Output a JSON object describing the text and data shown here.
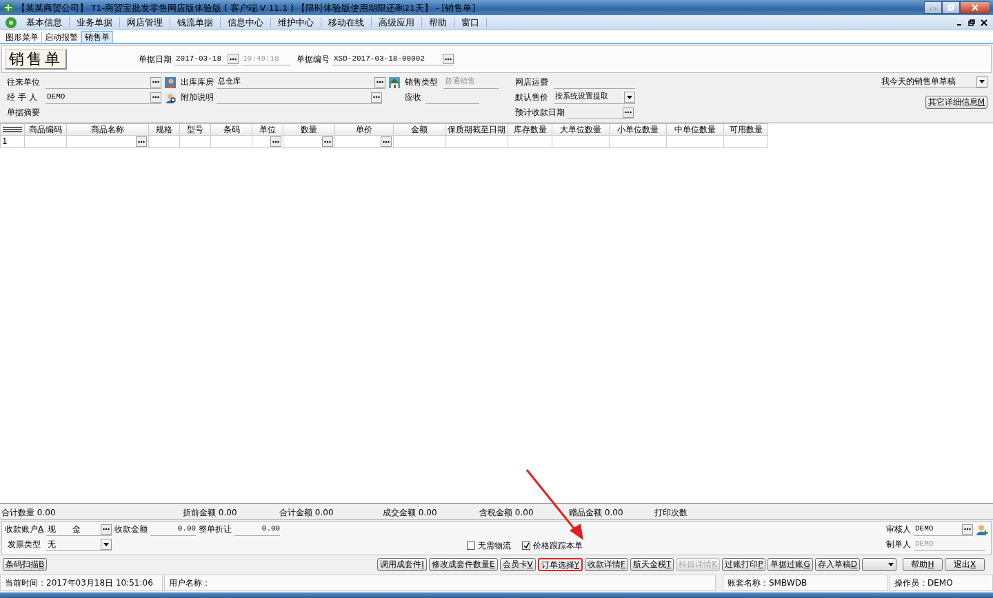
{
  "window": {
    "title": "【某某商贸公司】 T1-商贸宝批发零售网店版体验版 ( 客户端 V 11.1 ) 【限时体验版使用期限还剩21天】 - [销售单]"
  },
  "menu": [
    "基本信息",
    "业务单据",
    "网店管理",
    "钱流单据",
    "信息中心",
    "维护中心",
    "移动在线",
    "高级应用",
    "帮助",
    "窗口"
  ],
  "tabs": [
    {
      "label": "图形菜单",
      "selected": false
    },
    {
      "label": "启动报警",
      "selected": false
    },
    {
      "label": "销售单",
      "selected": true
    }
  ],
  "form_title": "销售单",
  "header_fields": [
    {
      "label": "单据日期",
      "value": "2017-03-18",
      "kind": "picker"
    },
    {
      "value": "10:49:18",
      "kind": "readonly"
    },
    {
      "label": "单据编号",
      "value": "XSD-2017-03-18-00002",
      "kind": "picker"
    }
  ],
  "form_columns": [
    [
      {
        "label": "往来单位",
        "kind": "picker"
      },
      {
        "label": "经 手 人",
        "value": "DEMO",
        "kind": "picker"
      },
      {
        "label": "单据摘要",
        "kind": "label"
      }
    ],
    [
      {
        "label": "出库库房",
        "value": "总仓库",
        "kind": "picker"
      },
      {
        "label": "附加说明",
        "kind": "picker"
      }
    ],
    [
      {
        "label": "销售类型",
        "value": "普通销售",
        "kind": "readonly"
      },
      {
        "label": "应收",
        "kind": "text"
      }
    ],
    [
      {
        "label": "网店运费",
        "kind": "text"
      },
      {
        "label": "默认售价",
        "value": "按系统设置提取",
        "kind": "dropdown"
      },
      {
        "label": "预计收款日期",
        "kind": "picker"
      }
    ]
  ],
  "draft_dropdown": {
    "value": "我今天的销售单草稿"
  },
  "details_button": {
    "label": "其它详细信息",
    "shortcut": "M"
  },
  "table": {
    "columns": [
      "商品编码",
      "商品名称",
      "规格",
      "型号",
      "条码",
      "单位",
      "数量",
      "单价",
      "金额",
      "保质期截至日期",
      "库存数量",
      "大单位数量",
      "小单位数量",
      "中单位数量",
      "可用数量"
    ],
    "rows": [
      {
        "number": "1",
        "cells": [
          {
            "kind": "text"
          },
          {
            "kind": "picker"
          },
          {
            "kind": "text"
          },
          {
            "kind": "text"
          },
          {
            "kind": "text"
          },
          {
            "kind": "picker"
          },
          {
            "kind": "picker"
          },
          {
            "kind": "picker"
          },
          {
            "kind": "text"
          },
          {
            "kind": "text"
          },
          {
            "kind": "text"
          },
          {
            "kind": "text"
          },
          {
            "kind": "text"
          },
          {
            "kind": "text"
          },
          {
            "kind": "text"
          }
        ]
      }
    ]
  },
  "totals": [
    {
      "label": "合计数量",
      "value": "0.00"
    },
    {
      "label": "折前金额",
      "value": "0.00"
    },
    {
      "label": "合计金额",
      "value": "0.00"
    },
    {
      "label": "成交金额",
      "value": "0.00"
    },
    {
      "label": "含税金额",
      "value": "0.00"
    },
    {
      "label": "赠品金额",
      "value": "0.00"
    },
    {
      "label": "打印次数"
    }
  ],
  "payment": {
    "account_label": "收款账户",
    "account_shortcut": "A",
    "account": "现　　金",
    "amount_label": "收款金额",
    "amount": "0.00",
    "discount_label": "整单折让",
    "discount": "0.00",
    "invoice_label": "发票类型",
    "invoice": "无"
  },
  "checkboxes": [
    {
      "label": "无需物流",
      "checked": false
    },
    {
      "label": "价格跟踪本单",
      "checked": true
    }
  ],
  "approver": {
    "label": "审核人",
    "value": "DEMO",
    "kind": "picker"
  },
  "creator": {
    "label": "制单人",
    "value": "DEMO",
    "kind": "readonly"
  },
  "scan_button": {
    "label": "条码扫描",
    "shortcut": "B"
  },
  "buttons": [
    {
      "label": "调用成套件",
      "shortcut": "I",
      "disabled": false,
      "highlighted": false
    },
    {
      "label": "修改成套件数量",
      "shortcut": "E",
      "disabled": false,
      "highlighted": false
    },
    {
      "label": "会员卡",
      "shortcut": "V",
      "disabled": false,
      "highlighted": false
    },
    {
      "label": "订单选择",
      "shortcut": "Y",
      "disabled": false,
      "highlighted": true
    },
    {
      "label": "收款详情",
      "shortcut": "F",
      "disabled": false,
      "highlighted": false
    },
    {
      "label": "航天金税",
      "shortcut": "T",
      "disabled": false,
      "highlighted": false
    },
    {
      "label": "科目详情",
      "shortcut": "K",
      "disabled": true,
      "highlighted": false
    },
    {
      "label": "过账打印",
      "shortcut": "P",
      "disabled": false,
      "highlighted": false
    },
    {
      "label": "单据过账",
      "shortcut": "G",
      "disabled": false,
      "highlighted": false
    },
    {
      "label": "存入草稿",
      "shortcut": "D",
      "disabled": false,
      "highlighted": false
    },
    {
      "kind": "dropdown",
      "disabled": false,
      "highlighted": false
    },
    {
      "label": "帮助",
      "shortcut": "H",
      "disabled": false,
      "highlighted": false
    },
    {
      "label": "退出",
      "shortcut": "X",
      "disabled": false,
      "highlighted": false
    }
  ],
  "status_bar": [
    {
      "label": "当前时间：",
      "value": "2017年03月18日  10:51:06"
    },
    {
      "label": "用户名称："
    },
    {
      "label": "账套名称：",
      "value": "SMBWDB"
    },
    {
      "label": "操作员：",
      "value": "DEMO"
    }
  ]
}
